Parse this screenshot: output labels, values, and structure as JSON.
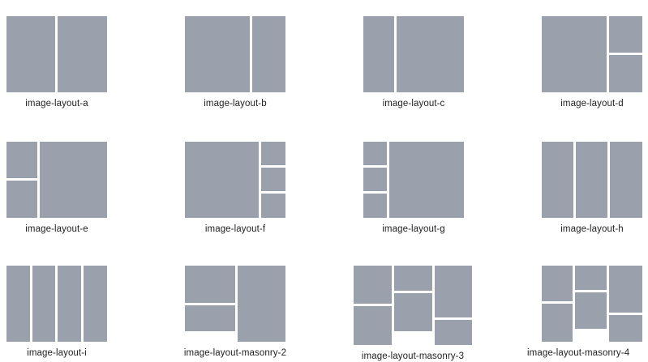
{
  "layouts": [
    {
      "label": "image-layout-a"
    },
    {
      "label": "image-layout-b"
    },
    {
      "label": "image-layout-c"
    },
    {
      "label": "image-layout-d"
    },
    {
      "label": "image-layout-e"
    },
    {
      "label": "image-layout-f"
    },
    {
      "label": "image-layout-g"
    },
    {
      "label": "image-layout-h"
    },
    {
      "label": "image-layout-i"
    },
    {
      "label": "image-layout-masonry-2"
    },
    {
      "label": "image-layout-masonry-3"
    },
    {
      "label": "image-layout-masonry-4"
    }
  ],
  "colors": {
    "tile": "#9ba1ac",
    "background": "#ffffff",
    "label_text": "#222222"
  }
}
